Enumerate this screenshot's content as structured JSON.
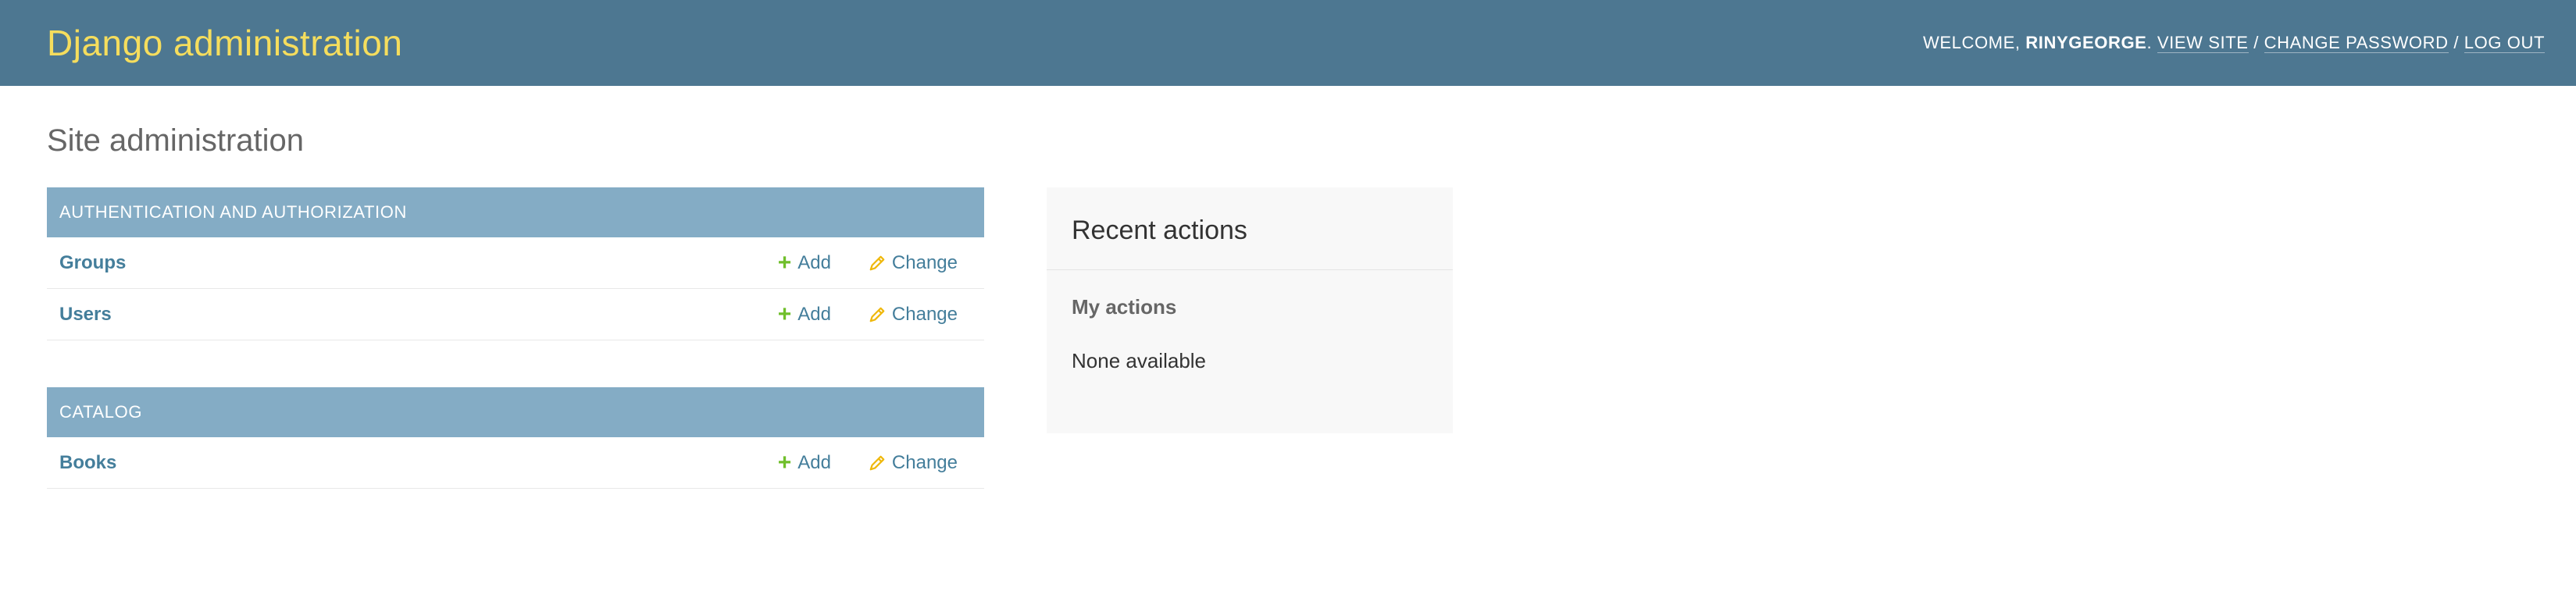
{
  "header": {
    "branding": "Django administration",
    "welcome_prefix": "Welcome,",
    "username": "RINYGEORGE",
    "username_suffix": ".",
    "links": {
      "view_site": "View site",
      "change_password": "Change password",
      "log_out": "Log out"
    },
    "separator": "/"
  },
  "page": {
    "title": "Site administration"
  },
  "modules": [
    {
      "caption": "Authentication and Authorization",
      "models": [
        {
          "name": "Groups",
          "add_label": "Add",
          "change_label": "Change"
        },
        {
          "name": "Users",
          "add_label": "Add",
          "change_label": "Change"
        }
      ]
    },
    {
      "caption": "Catalog",
      "models": [
        {
          "name": "Books",
          "add_label": "Add",
          "change_label": "Change"
        }
      ]
    }
  ],
  "recent_actions": {
    "title": "Recent actions",
    "subtitle": "My actions",
    "empty_text": "None available"
  },
  "icons": {
    "add": "plus-icon",
    "change": "pencil-icon"
  },
  "colors": {
    "header_bg": "#4d7791",
    "branding": "#f5dd5d",
    "module_caption_bg": "#84acc5",
    "link": "#447e9b",
    "add_icon": "#70bf2b",
    "change_icon": "#efb80b"
  }
}
